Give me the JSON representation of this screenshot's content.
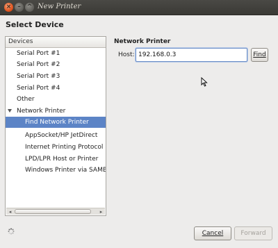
{
  "window": {
    "title": "New Printer"
  },
  "heading": "Select Device",
  "devices": {
    "header": "Devices",
    "items": [
      {
        "label": "Serial Port #1"
      },
      {
        "label": "Serial Port #2"
      },
      {
        "label": "Serial Port #3"
      },
      {
        "label": "Serial Port #4"
      },
      {
        "label": "Other"
      },
      {
        "label": "Network Printer"
      },
      {
        "label": "Find Network Printer",
        "selected": true
      },
      {
        "label": "AppSocket/HP JetDirect"
      },
      {
        "label": "Internet Printing Protocol (ip"
      },
      {
        "label": "LPD/LPR Host or Printer"
      },
      {
        "label": "Windows Printer via SAMBA"
      }
    ]
  },
  "network_printer": {
    "section_label": "Network Printer",
    "host_label": "Host:",
    "host_value": "192.168.0.3",
    "find_label": "Find"
  },
  "footer": {
    "cancel_label": "Cancel",
    "forward_label": "Forward"
  }
}
